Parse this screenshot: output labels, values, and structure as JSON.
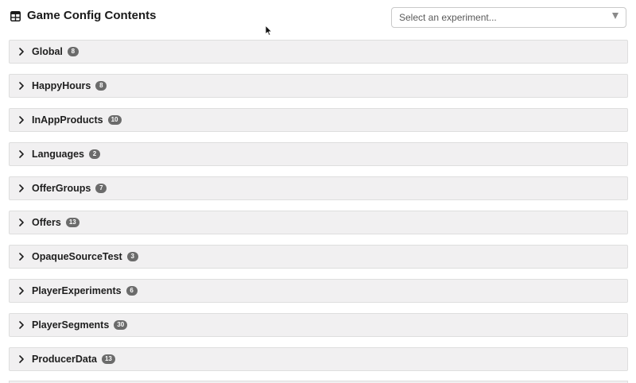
{
  "header": {
    "title": "Game Config Contents",
    "experiment_select": {
      "placeholder": "Select an experiment..."
    }
  },
  "sections": [
    {
      "name": "Global",
      "count": "8"
    },
    {
      "name": "HappyHours",
      "count": "8"
    },
    {
      "name": "InAppProducts",
      "count": "10"
    },
    {
      "name": "Languages",
      "count": "2"
    },
    {
      "name": "OfferGroups",
      "count": "7"
    },
    {
      "name": "Offers",
      "count": "13"
    },
    {
      "name": "OpaqueSourceTest",
      "count": "3"
    },
    {
      "name": "PlayerExperiments",
      "count": "6"
    },
    {
      "name": "PlayerSegments",
      "count": "30"
    },
    {
      "name": "ProducerData",
      "count": "13"
    }
  ],
  "colors": {
    "row_background": "#f1f0f1",
    "badge_background": "#6b6b6b",
    "text": "#1e1e1e"
  }
}
